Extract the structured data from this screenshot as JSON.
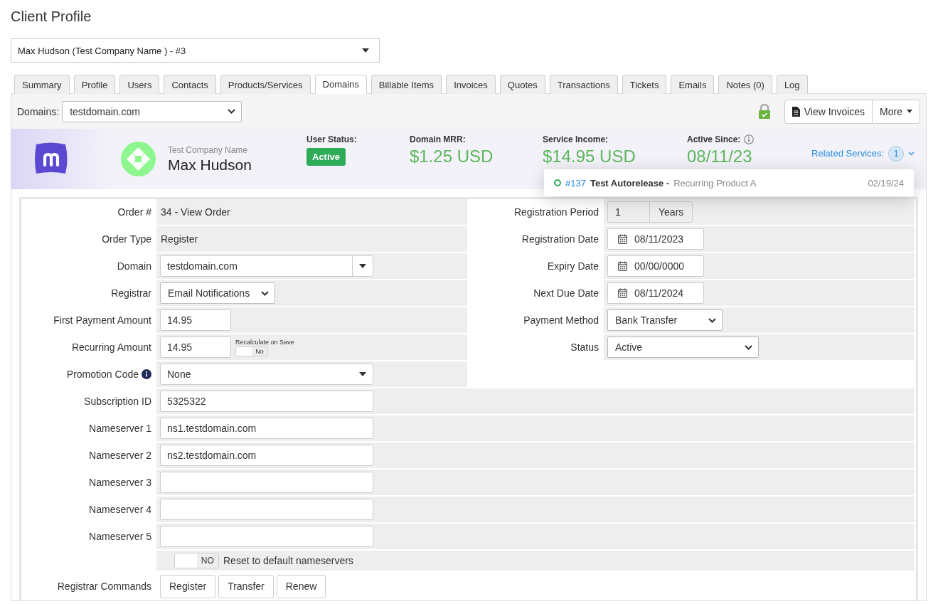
{
  "page_title": "Client Profile",
  "client_select": {
    "value": "Max Hudson (Test Company Name ) - #3"
  },
  "tabs": [
    {
      "label": "Summary",
      "selected": false
    },
    {
      "label": "Profile",
      "selected": false
    },
    {
      "label": "Users",
      "selected": false
    },
    {
      "label": "Contacts",
      "selected": false
    },
    {
      "label": "Products/Services",
      "selected": false
    },
    {
      "label": "Domains",
      "selected": true
    },
    {
      "label": "Billable Items",
      "selected": false
    },
    {
      "label": "Invoices",
      "selected": false
    },
    {
      "label": "Quotes",
      "selected": false
    },
    {
      "label": "Transactions",
      "selected": false
    },
    {
      "label": "Tickets",
      "selected": false
    },
    {
      "label": "Emails",
      "selected": false
    },
    {
      "label": "Notes (0)",
      "selected": false
    },
    {
      "label": "Log",
      "selected": false
    }
  ],
  "toolbar": {
    "domain_label": "Domains:",
    "domain_value": "testdomain.com",
    "ssl_active": true,
    "buttons": [
      {
        "label": "View Invoices",
        "kind": "icon"
      },
      {
        "label": "More",
        "kind": "caret"
      }
    ]
  },
  "header": {
    "company": "Test Company Name",
    "name": "Max Hudson",
    "stats": [
      {
        "kind": "badge",
        "label": "User Status:",
        "value": "Active",
        "color": "#2dab57"
      },
      {
        "kind": "money",
        "label": "Domain MRR:",
        "value": "$1.25 USD"
      },
      {
        "kind": "money",
        "label": "Service Income:",
        "value": "$14.95 USD"
      },
      {
        "kind": "info",
        "label": "Active Since:",
        "value": "08/11/23"
      }
    ],
    "related": {
      "label": "Related Services:",
      "count": "1",
      "expanded": true,
      "items": [
        {
          "id": "#137",
          "name": "Test Autorelease -",
          "product": "Recurring Product A",
          "date": "02/19/24",
          "color": "#2dab57"
        }
      ]
    }
  },
  "left_fields": [
    {
      "label": "Order #",
      "kind": "text",
      "value": "34 - View Order"
    },
    {
      "label": "Order Type",
      "kind": "text",
      "value": "Register"
    },
    {
      "label": "Domain",
      "kind": "combo",
      "value": "testdomain.com"
    },
    {
      "label": "Registrar",
      "kind": "select",
      "value": "Email Notifications"
    },
    {
      "label": "First Payment Amount",
      "kind": "input",
      "value": "14.95"
    },
    {
      "label": "Recurring Amount",
      "kind": "input",
      "value": "14.95",
      "toggle": {
        "label": "Recalculate on Save",
        "text": "No",
        "on": false
      }
    },
    {
      "label": "Promotion Code",
      "kind": "dropdown",
      "value": "None",
      "info": true
    }
  ],
  "right_fields": [
    {
      "label": "Registration Period",
      "kind": "period",
      "value": "1",
      "unit": "Years"
    },
    {
      "label": "Registration Date",
      "kind": "date",
      "value": "08/11/2023"
    },
    {
      "label": "Expiry Date",
      "kind": "date",
      "value": "00/00/0000"
    },
    {
      "label": "Next Due Date",
      "kind": "date",
      "value": "08/11/2024"
    },
    {
      "label": "Payment Method",
      "kind": "select",
      "value": "Bank Transfer"
    },
    {
      "label": "Status",
      "kind": "select",
      "value": "Active",
      "wide": true
    }
  ],
  "full_fields": [
    {
      "label": "Subscription ID",
      "kind": "input",
      "value": "5325322"
    },
    {
      "label": "Nameserver 1",
      "kind": "input",
      "value": "ns1.testdomain.com"
    },
    {
      "label": "Nameserver 2",
      "kind": "input",
      "value": "ns2.testdomain.com"
    },
    {
      "label": "Nameserver 3",
      "kind": "input"
    },
    {
      "label": "Nameserver 4",
      "kind": "input"
    },
    {
      "label": "Nameserver 5",
      "kind": "input"
    },
    {
      "kind": "switch",
      "text": "NO",
      "on": false,
      "caption": "Reset to default nameservers"
    },
    {
      "label": "Registrar Commands",
      "kind": "buttons",
      "buttons": [
        "Register",
        "Transfer",
        "Renew"
      ]
    }
  ]
}
